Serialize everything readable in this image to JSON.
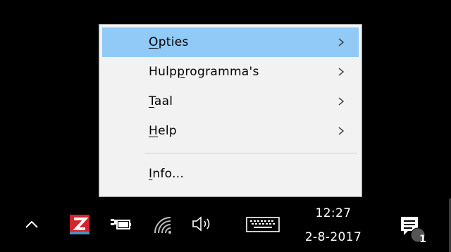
{
  "menu": {
    "items": [
      {
        "pre": "",
        "accel": "O",
        "post": "pties",
        "has_submenu": true,
        "highlighted": true
      },
      {
        "pre": "Hulp",
        "accel": "p",
        "post": "rogramma's",
        "has_submenu": true,
        "highlighted": false
      },
      {
        "pre": "",
        "accel": "T",
        "post": "aal",
        "has_submenu": true,
        "highlighted": false
      },
      {
        "pre": "",
        "accel": "H",
        "post": "elp",
        "has_submenu": true,
        "highlighted": false
      },
      {
        "pre": "",
        "accel": "I",
        "post": "nfo...",
        "has_submenu": false,
        "highlighted": false
      }
    ]
  },
  "taskbar": {
    "icons": [
      "chevron-up-icon",
      "zonealarm-z-icon",
      "battery-power-icon",
      "wifi-icon",
      "speaker-volume-icon",
      "keyboard-icon",
      "notification-center-icon"
    ],
    "clock_time": "12:27",
    "clock_date": "2-8-2017",
    "notification_count": "1"
  },
  "colors": {
    "menu_background": "#f2f2f2",
    "menu_highlight": "#91c9f7",
    "taskbar_background": "#000000",
    "zonealarm_red": "#d8222a"
  }
}
